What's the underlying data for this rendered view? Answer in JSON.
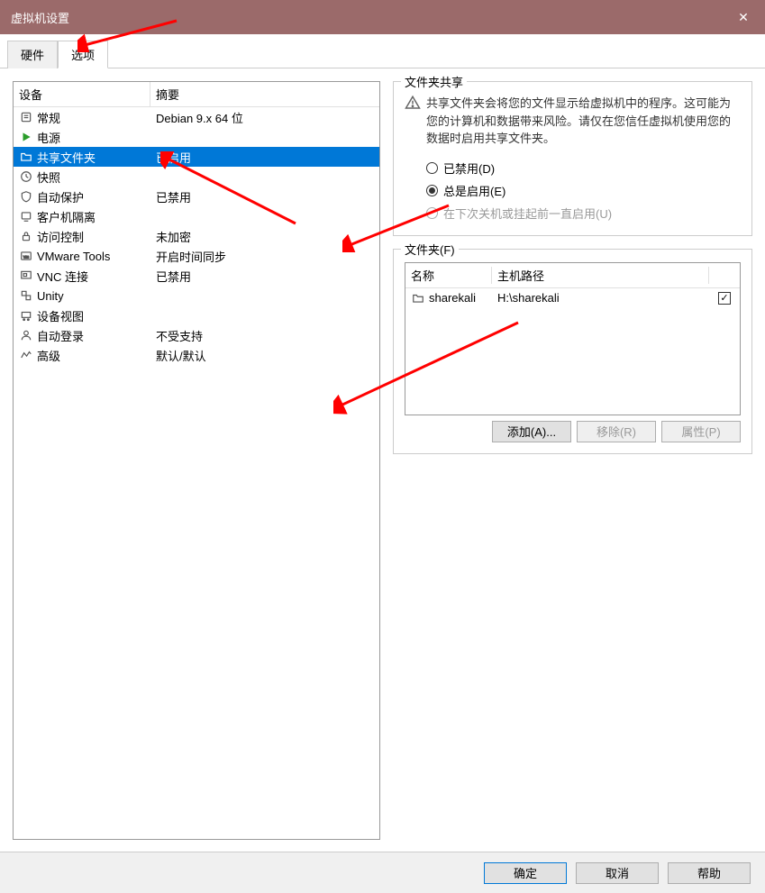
{
  "window": {
    "title": "虚拟机设置",
    "close": "✕"
  },
  "tabs": {
    "hardware": "硬件",
    "options": "选项"
  },
  "list": {
    "headers": {
      "device": "设备",
      "summary": "摘要"
    },
    "rows": [
      {
        "icon": "settings",
        "label": "常规",
        "summary": "Debian 9.x 64 位"
      },
      {
        "icon": "power",
        "label": "电源",
        "summary": ""
      },
      {
        "icon": "folder",
        "label": "共享文件夹",
        "summary": "已启用",
        "selected": true
      },
      {
        "icon": "clock",
        "label": "快照",
        "summary": ""
      },
      {
        "icon": "shield",
        "label": "自动保护",
        "summary": "已禁用"
      },
      {
        "icon": "guest",
        "label": "客户机隔离",
        "summary": ""
      },
      {
        "icon": "lock",
        "label": "访问控制",
        "summary": "未加密"
      },
      {
        "icon": "vm",
        "label": "VMware Tools",
        "summary": "开启时间同步"
      },
      {
        "icon": "vnc",
        "label": "VNC 连接",
        "summary": "已禁用"
      },
      {
        "icon": "unity",
        "label": "Unity",
        "summary": ""
      },
      {
        "icon": "device",
        "label": "设备视图",
        "summary": ""
      },
      {
        "icon": "login",
        "label": "自动登录",
        "summary": "不受支持"
      },
      {
        "icon": "advanced",
        "label": "高级",
        "summary": "默认/默认"
      }
    ]
  },
  "sharing": {
    "group_title": "文件夹共享",
    "warning": "共享文件夹会将您的文件显示给虚拟机中的程序。这可能为您的计算机和数据带来风险。请仅在您信任虚拟机使用您的数据时启用共享文件夹。",
    "radio_disabled": "已禁用(D)",
    "radio_always": "总是启用(E)",
    "radio_until": "在下次关机或挂起前一直启用(U)"
  },
  "folders": {
    "group_title": "文件夹(F)",
    "headers": {
      "name": "名称",
      "host": "主机路径"
    },
    "entries": [
      {
        "name": "sharekali",
        "host": "H:\\sharekali",
        "checked": true
      }
    ],
    "btn_add": "添加(A)...",
    "btn_remove": "移除(R)",
    "btn_props": "属性(P)"
  },
  "footer": {
    "ok": "确定",
    "cancel": "取消",
    "help": "帮助"
  }
}
